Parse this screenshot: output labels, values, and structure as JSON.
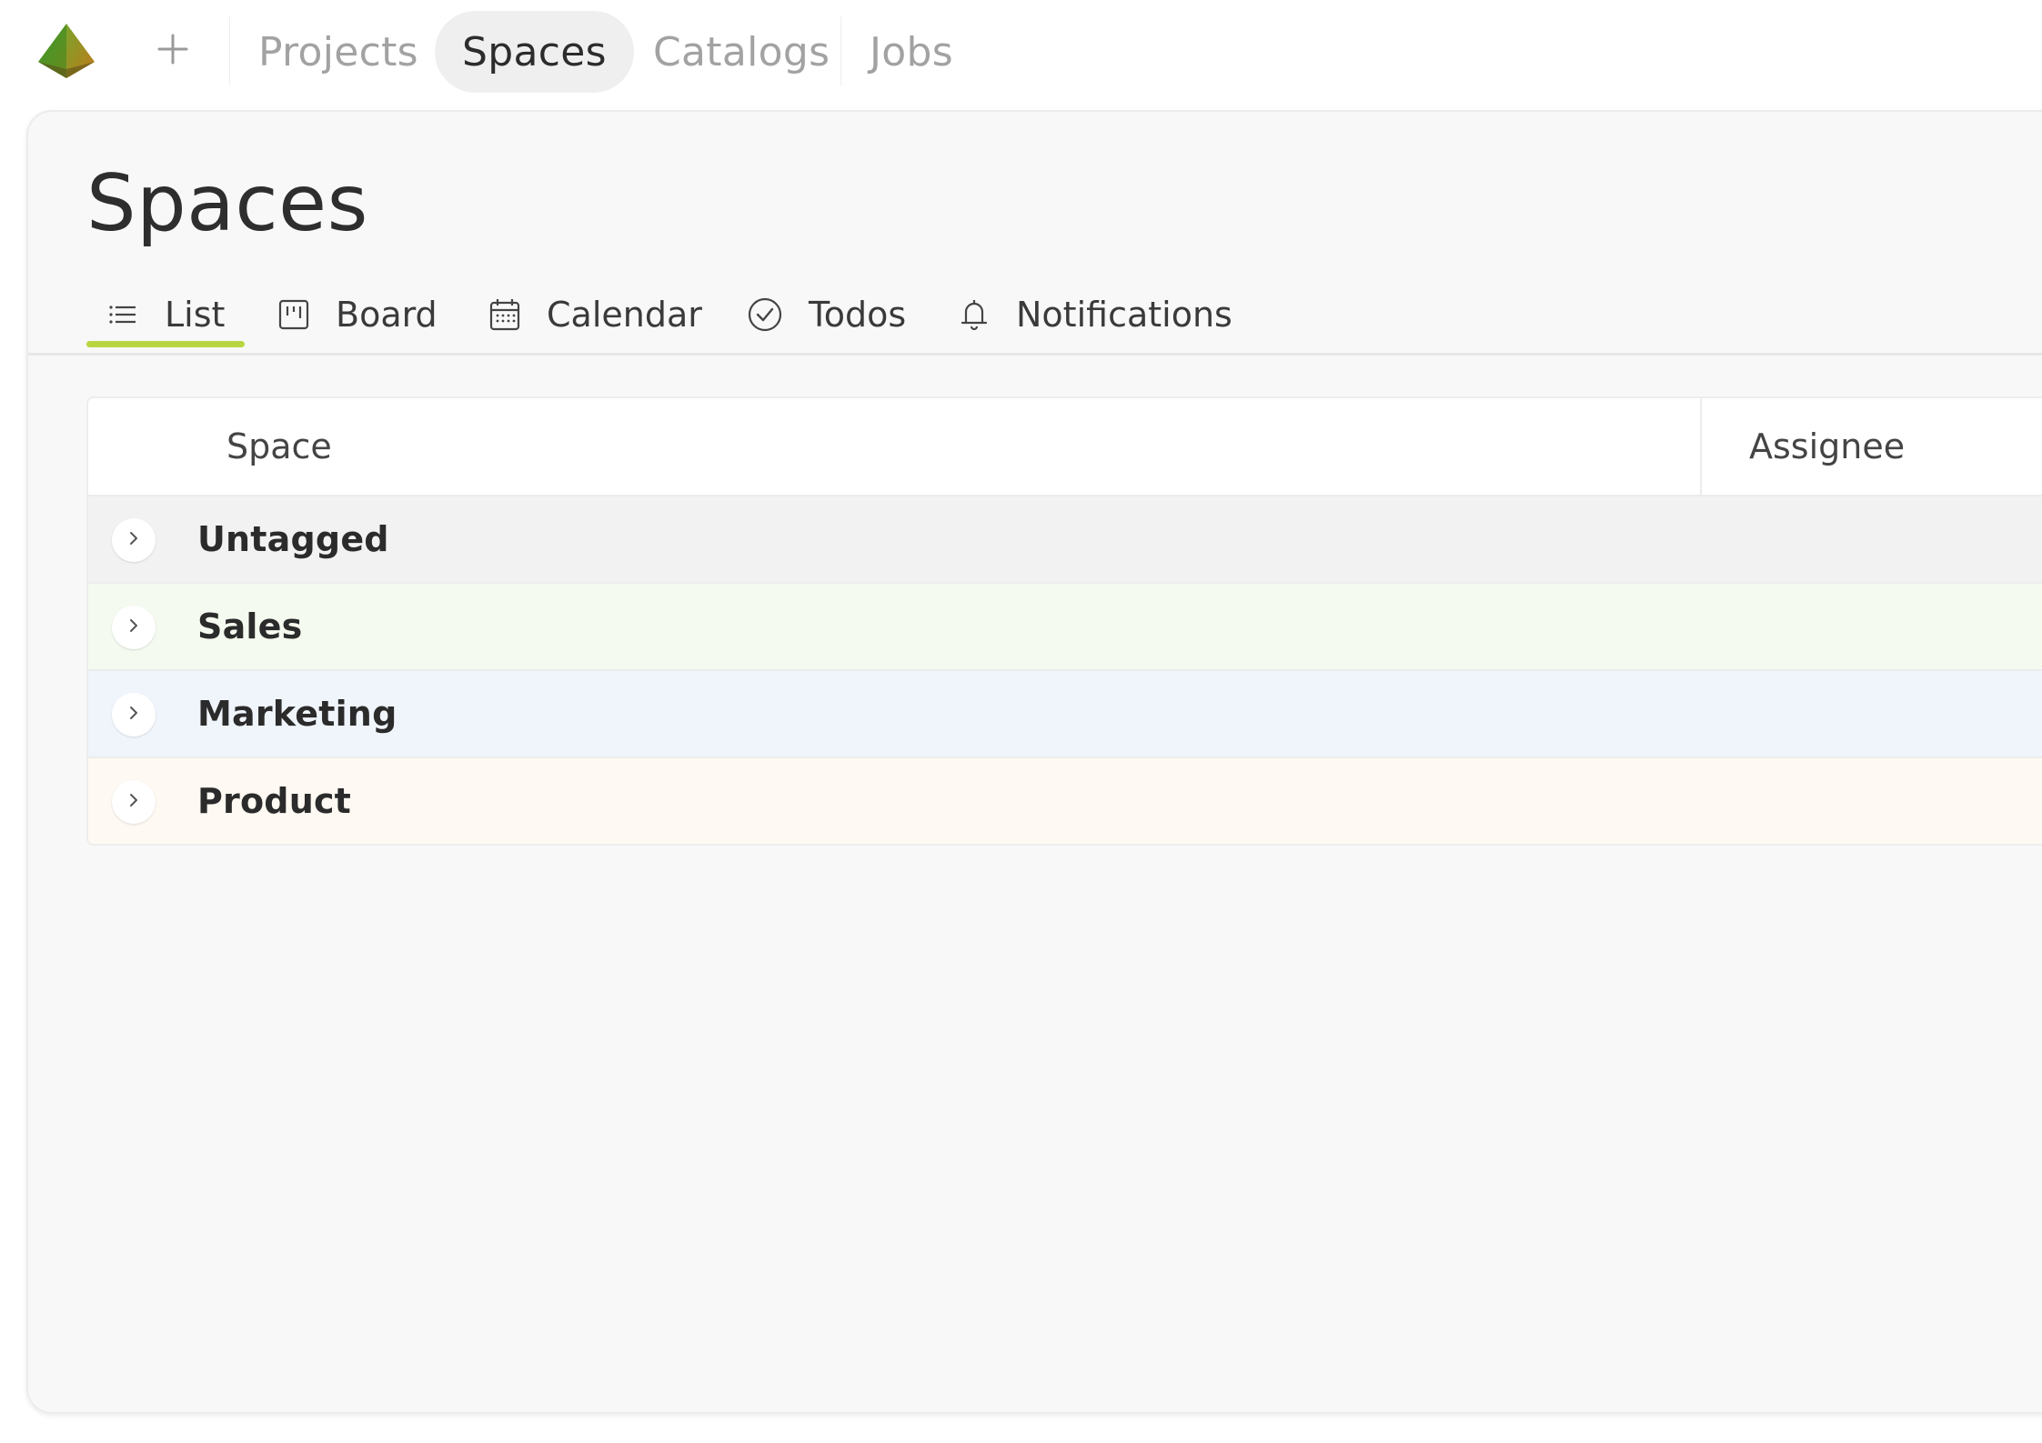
{
  "nav": {
    "items": [
      {
        "label": "Projects",
        "active": false
      },
      {
        "label": "Spaces",
        "active": true
      },
      {
        "label": "Catalogs",
        "active": false
      },
      {
        "label": "Jobs",
        "active": false
      }
    ],
    "add_icon": "plus-icon",
    "logo_icon": "pyramid-logo-icon"
  },
  "page": {
    "title": "Spaces"
  },
  "tabs": [
    {
      "label": "List",
      "icon": "list-icon",
      "active": true
    },
    {
      "label": "Board",
      "icon": "board-icon",
      "active": false
    },
    {
      "label": "Calendar",
      "icon": "calendar-icon",
      "active": false
    },
    {
      "label": "Todos",
      "icon": "check-circle-icon",
      "active": false
    },
    {
      "label": "Notifications",
      "icon": "bell-icon",
      "active": false
    }
  ],
  "table": {
    "columns": [
      "Space",
      "Assignee"
    ],
    "rows": [
      {
        "label": "Untagged",
        "color": "#f2f2f2"
      },
      {
        "label": "Sales",
        "color": "#f4faef"
      },
      {
        "label": "Marketing",
        "color": "#f0f5fc"
      },
      {
        "label": "Product",
        "color": "#fef9f2"
      }
    ]
  },
  "colors": {
    "accent": "#b8d640"
  }
}
